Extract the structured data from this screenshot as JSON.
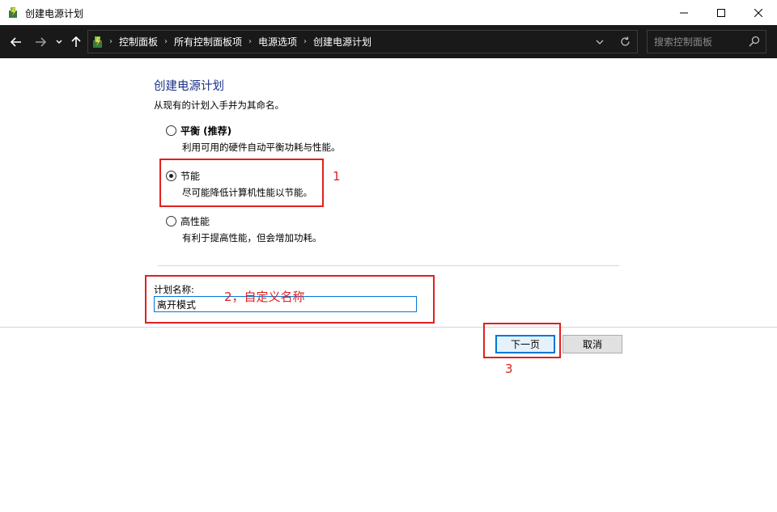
{
  "window": {
    "title": "创建电源计划"
  },
  "nav": {
    "breadcrumbs": [
      "控制面板",
      "所有控制面板项",
      "电源选项",
      "创建电源计划"
    ],
    "search_placeholder": "搜索控制面板"
  },
  "content": {
    "heading": "创建电源计划",
    "subtitle": "从现有的计划入手并为其命名。",
    "options": [
      {
        "label": "平衡 (推荐)",
        "description": "利用可用的硬件自动平衡功耗与性能。",
        "checked": false
      },
      {
        "label": "节能",
        "description": "尽可能降低计算机性能以节能。",
        "checked": true
      },
      {
        "label": "高性能",
        "description": "有利于提高性能，但会增加功耗。",
        "checked": false
      }
    ],
    "plan_name_label": "计划名称:",
    "plan_name_value": "离开模式"
  },
  "buttons": {
    "next": "下一页",
    "cancel": "取消"
  },
  "annotations": {
    "step1": "1",
    "step2": "2，自定义名称",
    "step3": "3",
    "color": "#e02020"
  }
}
